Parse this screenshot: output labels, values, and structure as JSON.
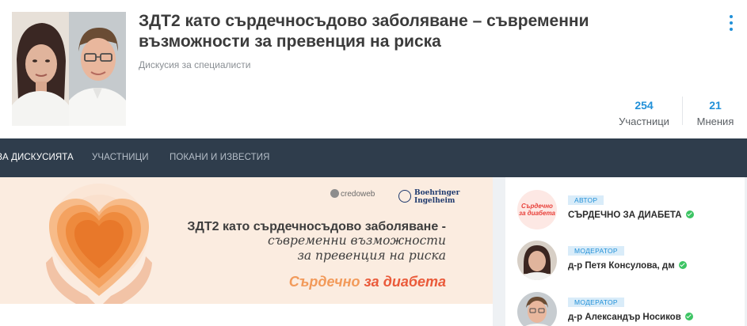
{
  "discussion": {
    "title": "ЗДТ2 като сърдечносъдово заболяване – съвременни възможности за превенция на риска",
    "subtitle": "Дискусия за специалисти",
    "menu_icon": "kebab-vertical-icon"
  },
  "stats": {
    "participants": {
      "value": "254",
      "label": "Участници"
    },
    "opinions": {
      "value": "21",
      "label": "Мнения"
    }
  },
  "tabs": [
    {
      "label": "ЗА ДИСКУСИЯТА",
      "active": true
    },
    {
      "label": "УЧАСТНИЦИ",
      "active": false
    },
    {
      "label": "ПОКАНИ И ИЗВЕСТИЯ",
      "active": false
    }
  ],
  "banner": {
    "logo_credoweb": "credoweb",
    "logo_boehringer_line1": "Boehringer",
    "logo_boehringer_line2": "Ingelheim",
    "headline_line1": "ЗДТ2 като сърдечносъдово заболяване -",
    "headline_line2": "съвременни възможности",
    "headline_line3": "за превенция на риска",
    "brand_part1": "Сърдечно",
    "brand_part2": "за диабета"
  },
  "members": [
    {
      "role": "АВТОР",
      "name": "СЪРДЕЧНО ЗА ДИАБЕТА",
      "avatar_text_line1": "Сърдечно",
      "avatar_text_line2": "за диабета",
      "verified": true
    },
    {
      "role": "МОДЕРАТОР",
      "name": "д-р Петя Консулова, дм",
      "verified": true
    },
    {
      "role": "МОДЕРАТОР",
      "name": "д-р Александър Носиков",
      "verified": true
    }
  ],
  "colors": {
    "accent": "#2190d8",
    "tabbar": "#2f3d4c",
    "banner_bg": "#fbece0",
    "brand_orange": "#f29a5a",
    "brand_red": "#ea5a3a",
    "verified": "#3cc463"
  }
}
